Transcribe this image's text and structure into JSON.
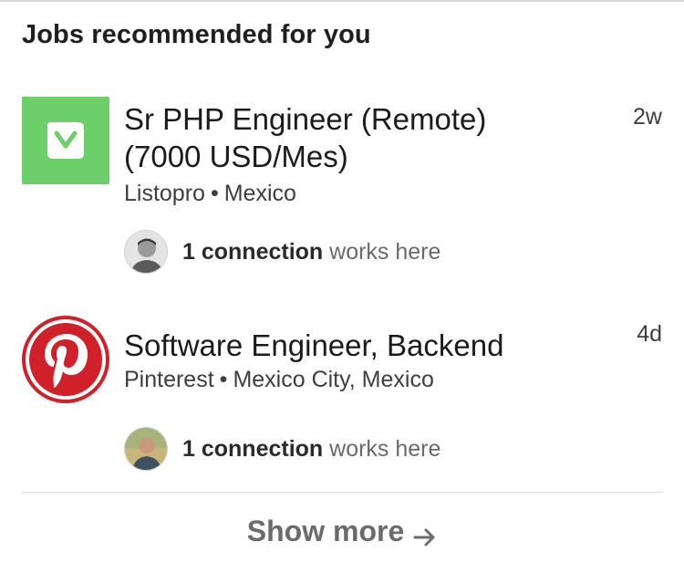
{
  "section": {
    "title": "Jobs recommended for you"
  },
  "jobs": [
    {
      "title_line1": "Sr PHP Engineer (Remote)",
      "title_line2": "(7000 USD/Mes)",
      "company": "Listopro",
      "location": "Mexico",
      "separator": "•",
      "posted": "2w",
      "connection_count": "1 connection",
      "connection_suffix": "works here",
      "logo_icon": "listopro-logo",
      "logo_color": "#6ccf6a"
    },
    {
      "title_line1": "Software Engineer, Backend",
      "company": "Pinterest",
      "location": "Mexico City, Mexico",
      "separator": "•",
      "posted": "4d",
      "connection_count": "1 connection",
      "connection_suffix": "works here",
      "logo_icon": "pinterest-logo",
      "logo_color": "#d02029"
    }
  ],
  "footer": {
    "show_more_label": "Show more",
    "arrow_icon": "arrow-right-icon"
  }
}
